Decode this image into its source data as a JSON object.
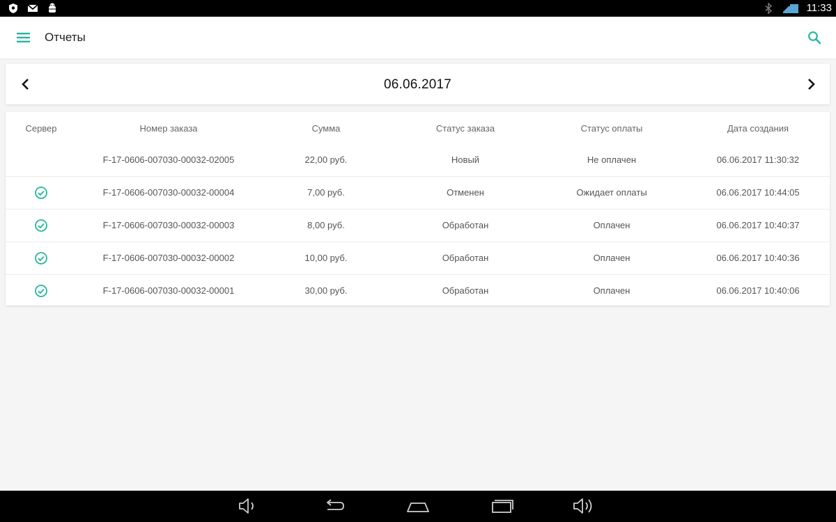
{
  "status_bar": {
    "time": "11:33",
    "left_icons": [
      "shield-icon",
      "gmail-icon",
      "android-debug-icon"
    ],
    "right_icons": [
      "bluetooth-icon",
      "network-icon"
    ]
  },
  "app_bar": {
    "title": "Отчеты",
    "menu_icon": "hamburger-menu-icon",
    "search_icon": "search-icon"
  },
  "date_nav": {
    "date": "06.06.2017",
    "prev_icon": "chevron-left-icon",
    "next_icon": "chevron-right-icon"
  },
  "table": {
    "columns": [
      "Сервер",
      "Номер заказа",
      "Сумма",
      "Статус заказа",
      "Статус оплаты",
      "Дата создания"
    ],
    "rows": [
      {
        "server_synced": false,
        "order": "F-17-0606-007030-00032-02005",
        "sum": "22,00 руб.",
        "status": "Новый",
        "payment": "Не оплачен",
        "created": "06.06.2017 11:30:32"
      },
      {
        "server_synced": true,
        "order": "F-17-0606-007030-00032-00004",
        "sum": "7,00 руб.",
        "status": "Отменен",
        "payment": "Ожидает оплаты",
        "created": "06.06.2017 10:44:05"
      },
      {
        "server_synced": true,
        "order": "F-17-0606-007030-00032-00003",
        "sum": "8,00 руб.",
        "status": "Обработан",
        "payment": "Оплачен",
        "created": "06.06.2017 10:40:37"
      },
      {
        "server_synced": true,
        "order": "F-17-0606-007030-00032-00002",
        "sum": "10,00 руб.",
        "status": "Обработан",
        "payment": "Оплачен",
        "created": "06.06.2017 10:40:36"
      },
      {
        "server_synced": true,
        "order": "F-17-0606-007030-00032-00001",
        "sum": "30,00 руб.",
        "status": "Обработан",
        "payment": "Оплачен",
        "created": "06.06.2017 10:40:06"
      }
    ]
  },
  "nav_bar": {
    "icons": [
      "volume-down-icon",
      "back-icon",
      "home-icon",
      "recents-icon",
      "volume-up-icon"
    ]
  },
  "colors": {
    "accent": "#26b5a0",
    "status_bar": "#000000",
    "background": "#f5f5f5"
  }
}
